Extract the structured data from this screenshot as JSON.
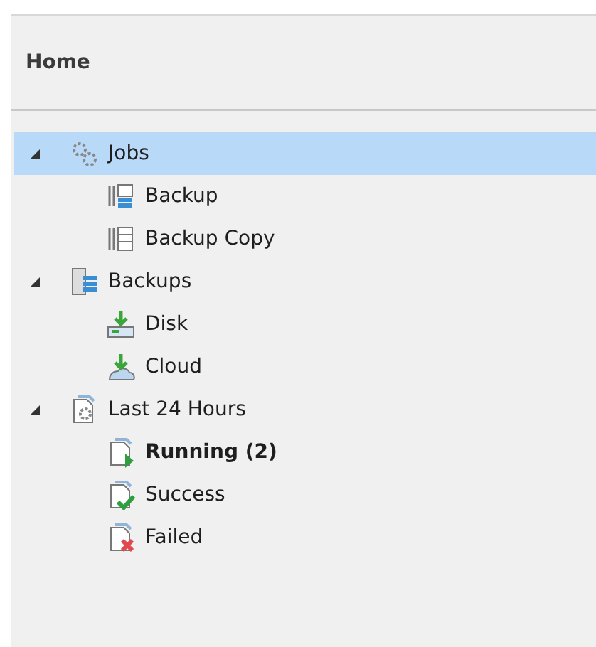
{
  "header": {
    "title": "Home"
  },
  "tree": [
    {
      "label": "Jobs",
      "kind": "gears",
      "expanded": true,
      "selected": true,
      "children": [
        {
          "label": "Backup",
          "kind": "job",
          "selected": false,
          "emphasized": false
        },
        {
          "label": "Backup Copy",
          "kind": "copyjob",
          "selected": false,
          "emphasized": false
        }
      ]
    },
    {
      "label": "Backups",
      "kind": "storage",
      "expanded": true,
      "selected": false,
      "children": [
        {
          "label": "Disk",
          "kind": "disk",
          "selected": false,
          "emphasized": false
        },
        {
          "label": "Cloud",
          "kind": "cloud",
          "selected": false,
          "emphasized": false
        }
      ]
    },
    {
      "label": "Last 24 Hours",
      "kind": "report",
      "expanded": true,
      "selected": false,
      "children": [
        {
          "label": "Running (2)",
          "kind": "running",
          "selected": false,
          "emphasized": true
        },
        {
          "label": "Success",
          "kind": "success",
          "selected": false,
          "emphasized": false
        },
        {
          "label": "Failed",
          "kind": "failed",
          "selected": false,
          "emphasized": false
        }
      ]
    }
  ]
}
